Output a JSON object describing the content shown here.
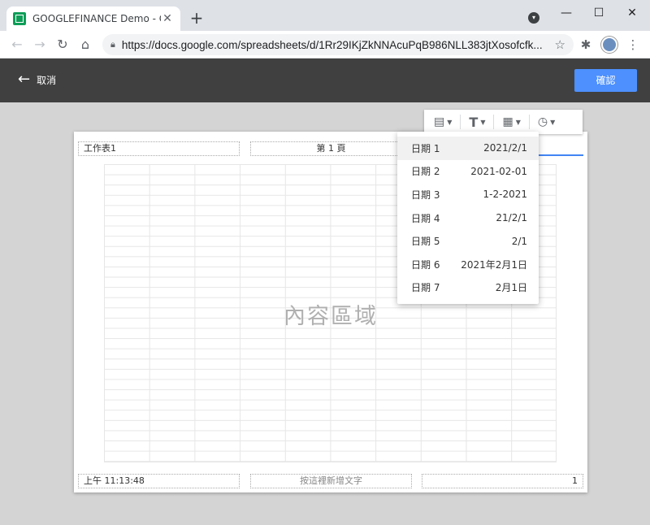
{
  "browser": {
    "tab_title": "GOOGLEFINANCE Demo - Goo",
    "tab_close": "✕",
    "new_tab": "+",
    "url": "https://docs.google.com/spreadsheets/d/1Rr29IKjZkNNAcuPqB986NLL383jtXosofcfk...",
    "window_controls": {
      "minimize": "—",
      "maximize": "☐",
      "close": "✕"
    }
  },
  "appbar": {
    "cancel_label": "取消",
    "confirm_label": "確認",
    "colors": {
      "bar": "#404040",
      "confirm_bg": "#4d90fe"
    }
  },
  "format_toolbar": {
    "buttons": [
      {
        "icon": "page-number-icon"
      },
      {
        "icon": "text-format-icon"
      },
      {
        "icon": "calendar-icon"
      },
      {
        "icon": "clock-icon"
      }
    ]
  },
  "page": {
    "header": {
      "left": "工作表1",
      "center": "第 1 頁",
      "right": ""
    },
    "footer": {
      "left": "上午 11:13:48",
      "center": "按這裡新增文字",
      "right": "1"
    },
    "content_label": "內容區域"
  },
  "date_menu": {
    "items": [
      {
        "label": "日期 1",
        "value": "2021/2/1"
      },
      {
        "label": "日期 2",
        "value": "2021-02-01"
      },
      {
        "label": "日期 3",
        "value": "1-2-2021"
      },
      {
        "label": "日期 4",
        "value": "21/2/1"
      },
      {
        "label": "日期 5",
        "value": "2/1"
      },
      {
        "label": "日期 6",
        "value": "2021年2月1日"
      },
      {
        "label": "日期 7",
        "value": "2月1日"
      }
    ]
  }
}
